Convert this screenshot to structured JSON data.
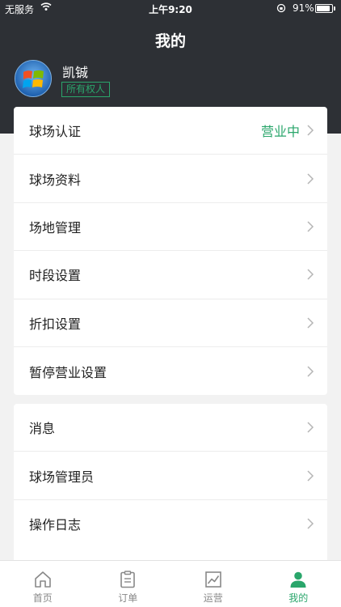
{
  "status_bar": {
    "carrier": "无服务",
    "time": "上午9:20",
    "battery": "91%",
    "battery_fraction": 0.91
  },
  "header": {
    "title": "我的",
    "user_name": "凯铖",
    "role_badge": "所有权人"
  },
  "menu_group_1": [
    {
      "label": "球场认证",
      "value": "营业中"
    },
    {
      "label": "球场资料"
    },
    {
      "label": "场地管理"
    },
    {
      "label": "时段设置"
    },
    {
      "label": "折扣设置"
    },
    {
      "label": "暂停营业设置"
    }
  ],
  "menu_group_2": [
    {
      "label": "消息"
    },
    {
      "label": "球场管理员"
    },
    {
      "label": "操作日志"
    }
  ],
  "tabbar": {
    "items": [
      {
        "label": "首页",
        "icon": "home-icon"
      },
      {
        "label": "订单",
        "icon": "clipboard-icon"
      },
      {
        "label": "运营",
        "icon": "chart-icon"
      },
      {
        "label": "我的",
        "icon": "user-icon",
        "active": true
      }
    ]
  },
  "colors": {
    "header_bg": "#2d3035",
    "accent": "#2aa66b",
    "background": "#f2f2f2"
  }
}
